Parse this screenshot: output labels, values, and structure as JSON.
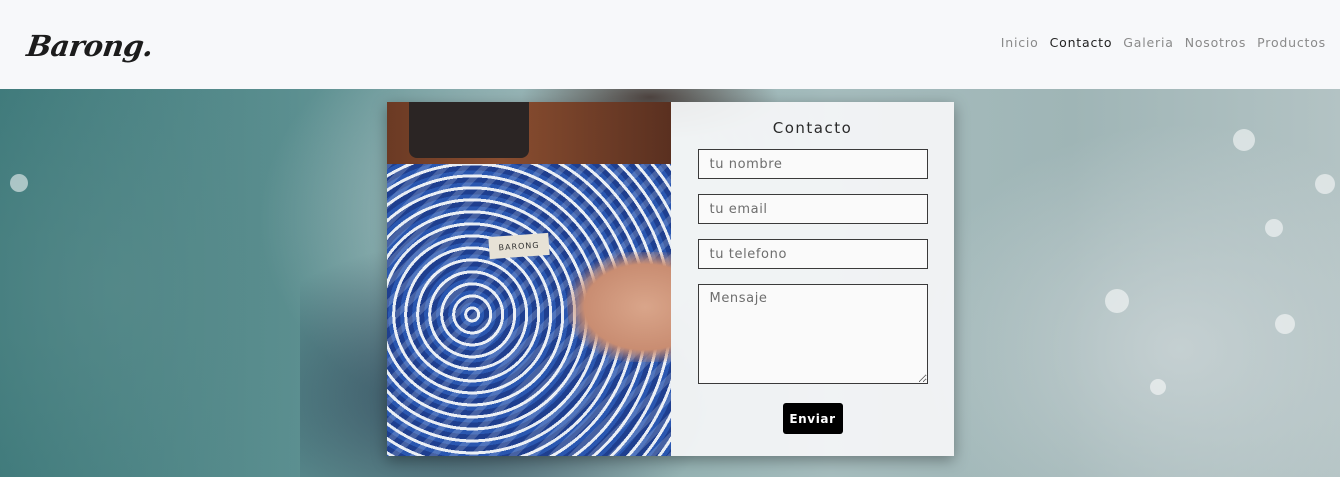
{
  "brand": {
    "name": "Barong."
  },
  "nav": {
    "items": [
      {
        "label": "Inicio",
        "active": false
      },
      {
        "label": "Contacto",
        "active": true
      },
      {
        "label": "Galeria",
        "active": false
      },
      {
        "label": "Nosotros",
        "active": false
      },
      {
        "label": "Productos",
        "active": false
      }
    ]
  },
  "photo": {
    "label_text": "BARONG"
  },
  "contact_form": {
    "title": "Contacto",
    "name_placeholder": "tu nombre",
    "email_placeholder": "tu email",
    "phone_placeholder": "tu telefono",
    "message_placeholder": "Mensaje",
    "submit_label": "Enviar"
  },
  "colors": {
    "page_background": "#f7f8fa",
    "button_background": "#000000",
    "active_nav": "#222222",
    "inactive_nav": "#8a8a8a"
  }
}
